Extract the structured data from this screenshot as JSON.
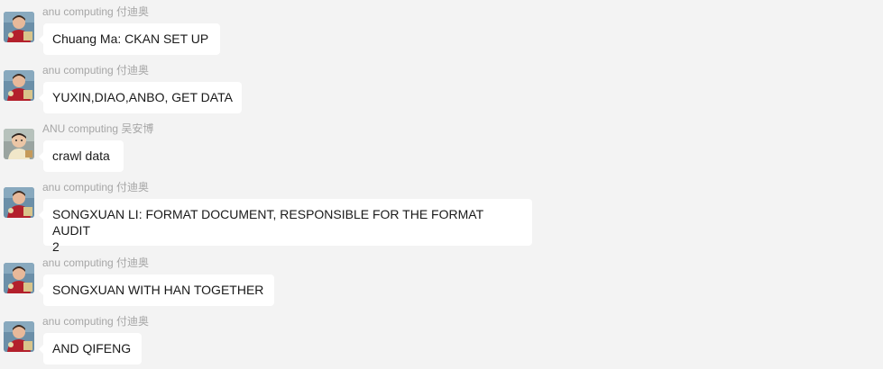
{
  "messages": [
    {
      "sender": "anu computing 付迪奥",
      "text": "Chuang Ma: CKAN SET UP",
      "avatar": "avatar-person-red"
    },
    {
      "sender": "anu computing 付迪奥",
      "text": "YUXIN,DIAO,ANBO, GET DATA",
      "avatar": "avatar-person-red"
    },
    {
      "sender": "ANU computing 吴安博",
      "text": "crawl data",
      "avatar": "avatar-person-child"
    },
    {
      "sender": "anu computing 付迪奥",
      "text": "SONGXUAN LI: FORMAT DOCUMENT, RESPONSIBLE FOR THE FORMAT AUDIT\n2",
      "avatar": "avatar-person-red"
    },
    {
      "sender": "anu computing 付迪奥",
      "text": "SONGXUAN WITH HAN TOGETHER",
      "avatar": "avatar-person-red"
    },
    {
      "sender": "anu computing 付迪奥",
      "text": "AND QIFENG",
      "avatar": "avatar-person-red"
    }
  ],
  "colors": {
    "background": "#f3f3f3",
    "bubble": "#ffffff",
    "sender_text": "#a6a6a6",
    "message_text": "#191919"
  }
}
